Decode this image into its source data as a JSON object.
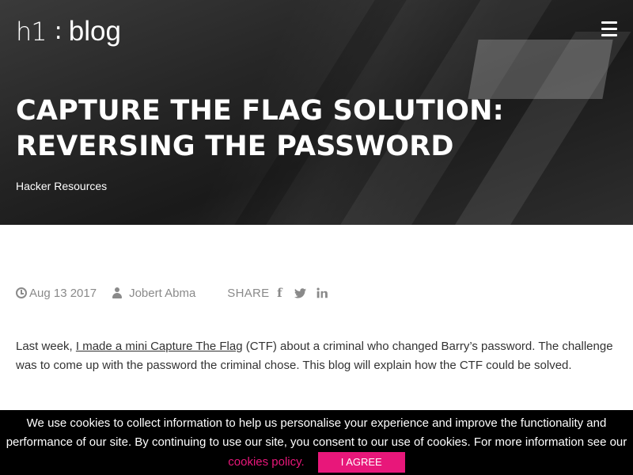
{
  "header": {
    "logo_mark": "h1",
    "logo_separator": ":",
    "logo_text": "blog",
    "menu_icon": "hamburger-menu-icon"
  },
  "hero": {
    "title_line1": "Capture the Flag Solution:",
    "title_line2": "Reversing the Password",
    "category": "Hacker Resources"
  },
  "meta": {
    "date": "Aug 13 2017",
    "author": "Jobert Abma",
    "share_label": "SHARE",
    "date_icon": "clock-icon",
    "author_icon": "user-icon",
    "social_icons": [
      "facebook-icon",
      "twitter-icon",
      "linkedin-icon"
    ]
  },
  "article": {
    "intro_before_link": "Last week, ",
    "intro_link": "I made a mini Capture The Flag",
    "intro_after_link": " (CTF) about a criminal who changed Barry’s password. The challenge was to come up with the password the criminal chose. This blog will explain how the CTF could be solved."
  },
  "cookie_bar": {
    "message": "We use cookies to collect information to help us personalise your experience and improve the functionality and performance of our site. By continuing to use our site, you consent to our use of cookies. For more information see our ",
    "policy_link": "cookies policy.",
    "agree_label": "I agree"
  },
  "colors": {
    "accent": "#e8177a",
    "meta_text": "#8a8a8a",
    "cookie_bg": "#000000"
  }
}
